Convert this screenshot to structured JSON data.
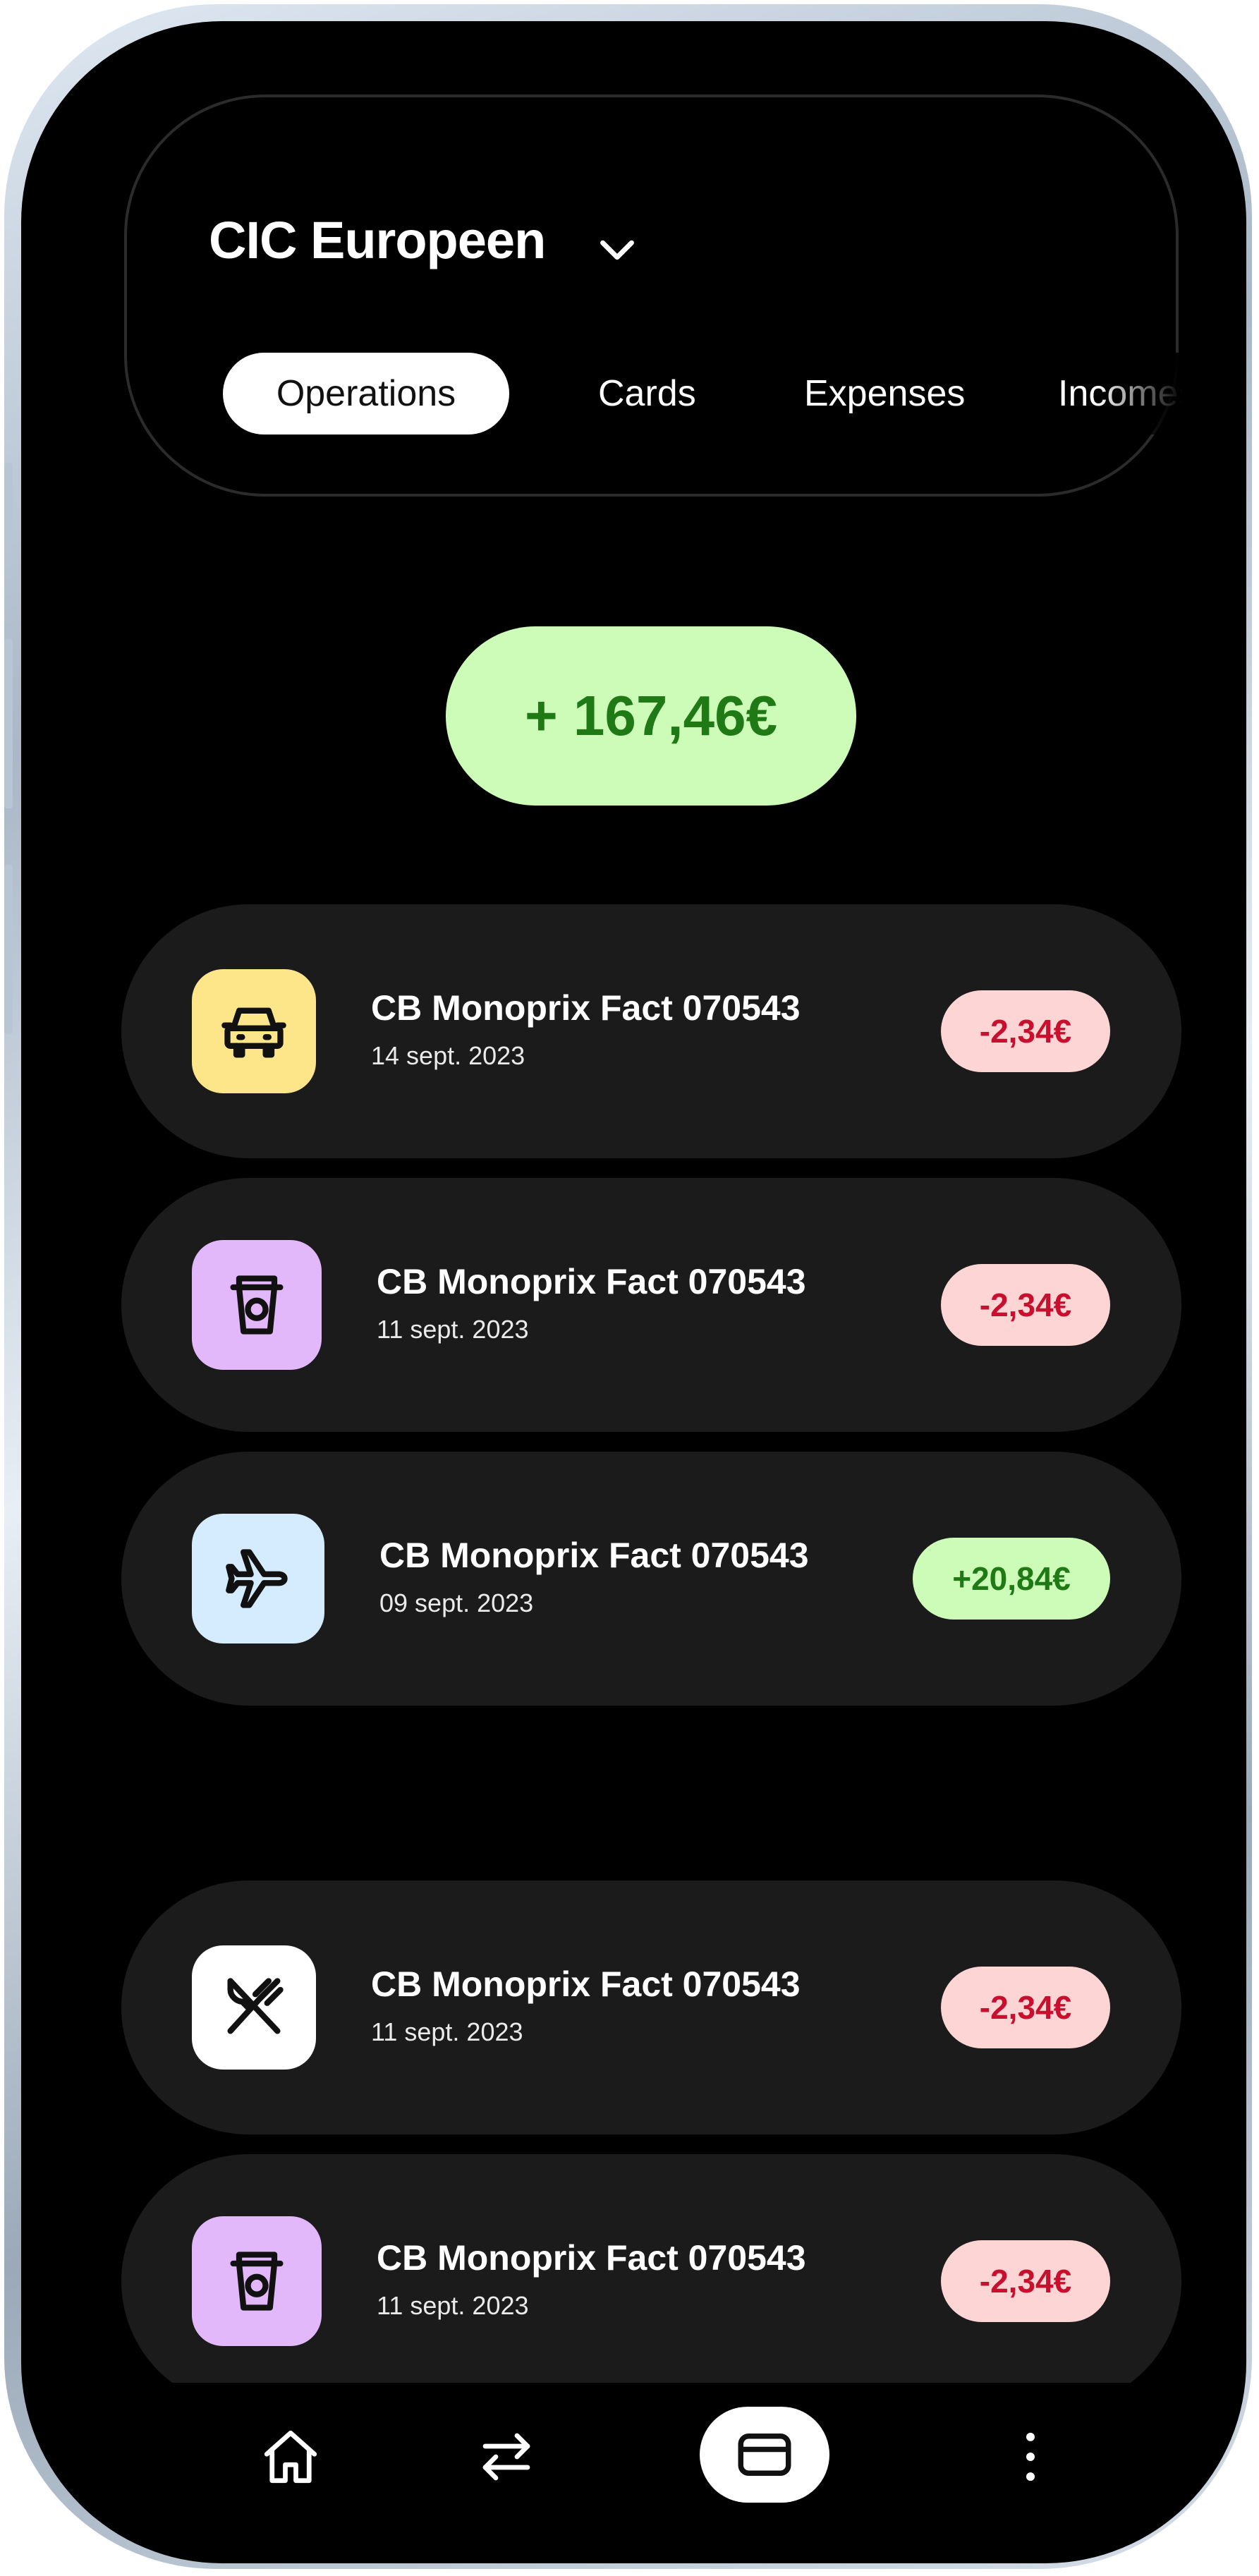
{
  "account": {
    "name": "CIC Europeen"
  },
  "tabs": [
    {
      "label": "Operations",
      "active": true
    },
    {
      "label": "Cards",
      "active": false
    },
    {
      "label": "Expenses",
      "active": false
    },
    {
      "label": "Incomes",
      "active": false
    }
  ],
  "balance": {
    "value": "+ 167,46€",
    "color": "#1f7a15",
    "background": "#cdfbb8"
  },
  "transactions": [
    {
      "title": "CB Monoprix Fact 070543",
      "date": "14 sept. 2023",
      "amount": "-2,34€",
      "type": "negative",
      "icon": "car-icon",
      "icon_bg": "#fde68a"
    },
    {
      "title": "CB Monoprix Fact 070543",
      "date": "11 sept. 2023",
      "amount": "-2,34€",
      "type": "negative",
      "icon": "coffee-cup-icon",
      "icon_bg": "#e3b8fb"
    },
    {
      "title": "CB Monoprix Fact 070543",
      "date": "09 sept. 2023",
      "amount": "+20,84€",
      "type": "positive",
      "icon": "airplane-icon",
      "icon_bg": "#d4ecfd"
    },
    {
      "title": "CB Monoprix Fact 070543",
      "date": "11 sept. 2023",
      "amount": "-2,34€",
      "type": "negative",
      "icon": "fork-knife-icon",
      "icon_bg": "#ffffff"
    },
    {
      "title": "CB Monoprix Fact 070543",
      "date": "11 sept. 2023",
      "amount": "-2,34€",
      "type": "negative",
      "icon": "coffee-cup-icon",
      "icon_bg": "#e3b8fb"
    }
  ],
  "bottom_nav": [
    {
      "icon": "home-icon",
      "active": false
    },
    {
      "icon": "transfer-icon",
      "active": false
    },
    {
      "icon": "card-icon",
      "active": true
    },
    {
      "icon": "more-vertical-icon",
      "active": false
    }
  ],
  "colors": {
    "negative_bg": "#fdd5d5",
    "negative_text": "#c8102e",
    "positive_bg": "#cdfbb8",
    "positive_text": "#1f7a15",
    "card_bg": "#1b1b1b"
  }
}
